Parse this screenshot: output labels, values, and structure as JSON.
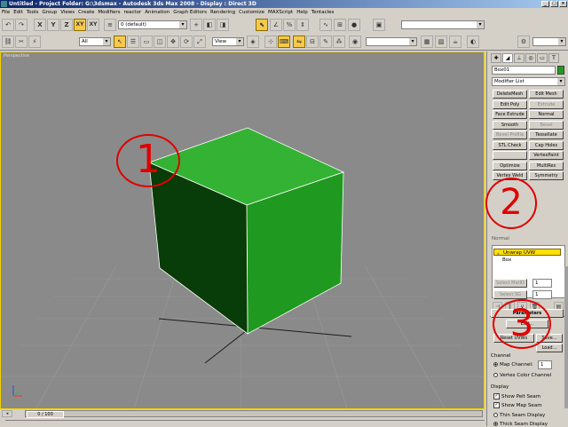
{
  "window": {
    "title": "Untitled - Project Folder: G:\\3dsmax - Autodesk 3ds Max 2008 - Display : Direct 3D"
  },
  "menu": [
    "File",
    "Edit",
    "Tools",
    "Group",
    "Views",
    "Create",
    "Modifiers",
    "reactor",
    "Animation",
    "Graph Editors",
    "Rendering",
    "Customize",
    "MAXScript",
    "Help",
    "Tentacles"
  ],
  "toolbar1": {
    "axis_labels": [
      "X",
      "Y",
      "Z",
      "XY",
      "XY"
    ],
    "layer_dropdown": "0 (default)"
  },
  "toolbar2": {
    "selection_filter": "All",
    "ref_coord": "View"
  },
  "viewport": {
    "label": "Perspective",
    "annotation_1": "1",
    "cube_color": "#1c9e1c"
  },
  "command_panel": {
    "object_name": "Box01",
    "object_color": "#1c9e1c",
    "modifier_list": "Modifier List",
    "modifier_buttons": [
      {
        "label": "DeleteMesh",
        "enabled": true
      },
      {
        "label": "Edit Mesh",
        "enabled": true
      },
      {
        "label": "Edit Poly",
        "enabled": true
      },
      {
        "label": "Extrude",
        "enabled": false
      },
      {
        "label": "Face Extrude",
        "enabled": true
      },
      {
        "label": "Normal",
        "enabled": true
      },
      {
        "label": "Smooth",
        "enabled": true
      },
      {
        "label": "Bevel",
        "enabled": false
      },
      {
        "label": "Bevel Profile",
        "enabled": false
      },
      {
        "label": "Tessellate",
        "enabled": true
      },
      {
        "label": "STL Check",
        "enabled": true
      },
      {
        "label": "Cap Holes",
        "enabled": true
      },
      {
        "label": "",
        "enabled": true
      },
      {
        "label": "VertexPaint",
        "enabled": true
      },
      {
        "label": "Optimize",
        "enabled": true
      },
      {
        "label": "MultiRes",
        "enabled": true
      },
      {
        "label": "Vertex Weld",
        "enabled": true
      },
      {
        "label": "Symmetry",
        "enabled": true
      }
    ],
    "sub_label": "Normal",
    "stack_items": [
      "Unwrap UVW",
      "Box"
    ],
    "annotation_2": "2",
    "select_matid": "Select MatID",
    "select_sg": "Select SG",
    "select_matid_value": "1",
    "select_sg_value": "1",
    "parameters": "Parameters",
    "edit_button": "Edit...",
    "reset_uvws": "Reset UVWs",
    "save": "Save...",
    "load": "Load...",
    "annotation_3": "3",
    "channel_group": "Channel",
    "map_channel_label": "Map Channel:",
    "map_channel_value": "1",
    "vertex_color_channel": "Vertex Color Channel",
    "display_group": "Display",
    "show_pelt_seam": "Show Pelt Seam",
    "show_map_seam": "Show Map Seam",
    "thin_seam_display": "Thin Seam Display",
    "thick_seam_display": "Thick Seam Display"
  },
  "status": {
    "time_slider": "0 / 100"
  }
}
